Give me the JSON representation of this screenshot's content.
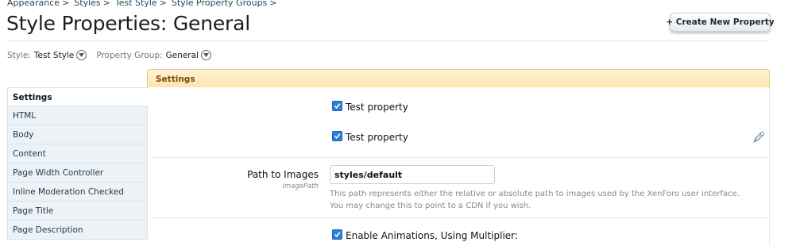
{
  "breadcrumb": {
    "items": [
      "Appearance",
      "Styles",
      "Test Style",
      "Style Property Groups"
    ],
    "separator": ">"
  },
  "page": {
    "title": "Style Properties: General",
    "create_button": "+ Create New Property"
  },
  "filters": {
    "style_label": "Style:",
    "style_value": "Test Style",
    "group_label": "Property Group:",
    "group_value": "General"
  },
  "panel": {
    "header": "Settings"
  },
  "sidebar": {
    "items": [
      {
        "label": "Settings",
        "active": true
      },
      {
        "label": "HTML",
        "active": false
      },
      {
        "label": "Body",
        "active": false
      },
      {
        "label": "Content",
        "active": false
      },
      {
        "label": "Page Width Controller",
        "active": false
      },
      {
        "label": "Inline Moderation Checked",
        "active": false
      },
      {
        "label": "Page Title",
        "active": false
      },
      {
        "label": "Page Description",
        "active": false
      }
    ]
  },
  "properties": {
    "check1": {
      "label": "Test property",
      "checked": true
    },
    "check2": {
      "label": "Test property",
      "checked": true
    },
    "path": {
      "label": "Path to Images",
      "sublabel": "imagePath",
      "value": "styles/default",
      "help_line1": "This path represents either the relative or absolute path to images used by the XenForo user interface.",
      "help_line2": "You may change this to point to a CDN if you wish."
    },
    "check3": {
      "label": "Enable Animations, Using Multiplier:",
      "checked": true
    }
  },
  "colors": {
    "accent": "#2f7fd6",
    "header_bg": "#fde4b0",
    "header_text": "#7a4b08",
    "link": "#2b485c"
  }
}
